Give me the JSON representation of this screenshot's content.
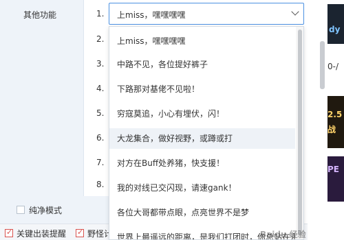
{
  "nav": {
    "other_functions": "其他功能"
  },
  "numbers": [
    "1.",
    "2.",
    "3.",
    "4.",
    "5.",
    "6.",
    "7.",
    "8."
  ],
  "select": {
    "value": "上miss，嘿嘿嘿嘿"
  },
  "dropdown": {
    "options": [
      "上miss，嘿嘿嘿嘿",
      "中路不见，各位提好裤子",
      "下路那对基佬不见啦！",
      "穷寇莫追，小心有埋伏，闪！",
      "大龙集合，做好视野，或蹲或打",
      "对方在Buff处养猪，快支援！",
      "我的对线已交闪现，请速gank！",
      "各位大哥都带点眼，点亮世界不是梦",
      "世界上最遥远的距离，是我们打团时，你总站在永"
    ],
    "hover_index": 4
  },
  "bottom": {
    "pure_mode": "纯净模式",
    "key_item_alert": "关键出装提醒",
    "jungle_label": "野怪计"
  },
  "right_strip": {
    "thumb1": "dy",
    "thumb2": "0-/",
    "thumb3": "2.5",
    "thumb4": "战",
    "thumb5": "PE"
  },
  "watermark": "Baidu 经验"
}
